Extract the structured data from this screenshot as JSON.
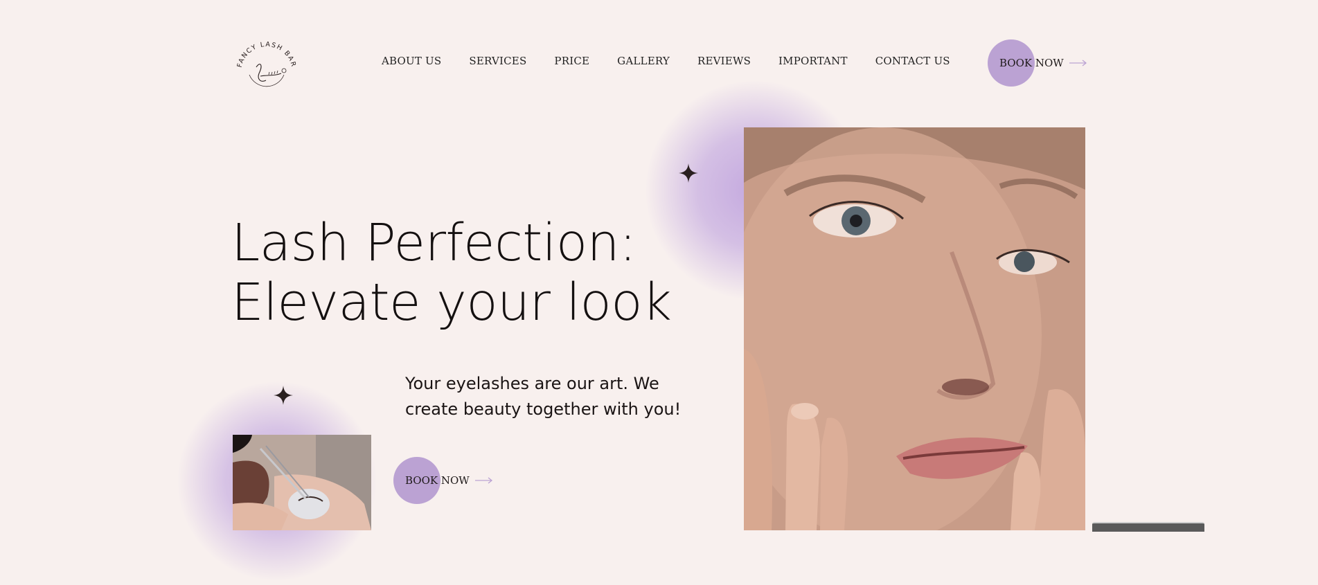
{
  "logo": {
    "text": "FANCY LASH BAR",
    "icon": "lash-logo-icon"
  },
  "nav": {
    "items": [
      "ABOUT US",
      "SERVICES",
      "PRICE",
      "GALLERY",
      "REVIEWS",
      "IMPORTANT",
      "CONTACT US"
    ]
  },
  "header": {
    "book_label": "BOOK NOW",
    "arrow_icon": "arrow-right-icon"
  },
  "hero": {
    "title_line1": "Lash Perfection:",
    "title_line2": "Elevate your look",
    "tagline_line1": "Your eyelashes are our art. We",
    "tagline_line2": "create beauty together with you!",
    "book_label": "BOOK NOW",
    "main_image": "woman-face-closeup-photo",
    "small_image": "eyelash-extension-procedure-photo",
    "sparkle_icon": "sparkle-icon"
  },
  "colors": {
    "background": "#f8f0ee",
    "accent": "#bba2d3",
    "text": "#1c1414"
  }
}
